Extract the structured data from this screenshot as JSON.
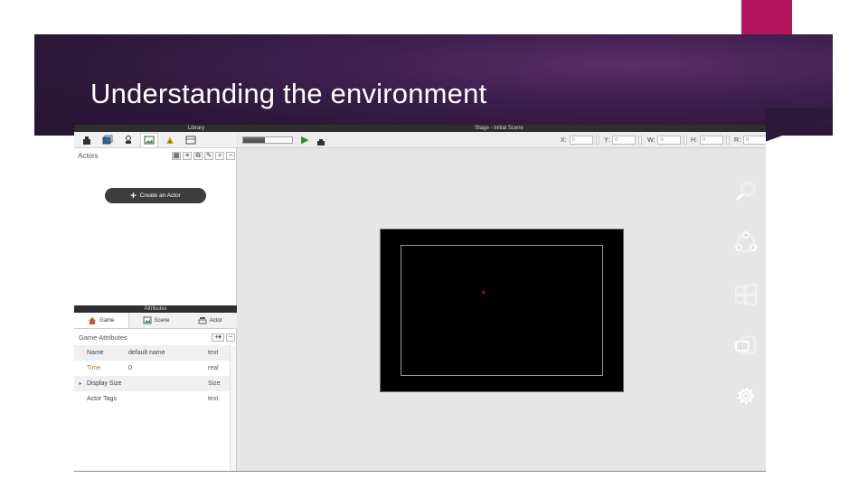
{
  "slide": {
    "title": "Understanding the environment",
    "accent_color": "#b5175e",
    "banner_color": "#2c1838"
  },
  "app": {
    "library_title": "Library",
    "scene_title": "Stage - Initial Scene",
    "library_tabs": [
      "actors-tab-icon",
      "scenes-tab-icon",
      "behaviors-tab-icon",
      "images-tab-icon",
      "sounds-tab-icon",
      "tables-tab-icon"
    ],
    "actors_label": "Actors",
    "actors_buttons": [
      "grid",
      "list",
      "duplicate",
      "delete",
      "+",
      "−"
    ],
    "create_actor_label": "Create an Actor",
    "attributes": {
      "header": "Attributes",
      "tabs": [
        "Game",
        "Scene",
        "Actor"
      ],
      "section_label": "Game Attributes",
      "add_label": "+▾",
      "remove_label": "−",
      "rows": [
        {
          "name": "Name",
          "value": "default name",
          "type": "text",
          "expandable": false
        },
        {
          "name": "Time",
          "value": "0",
          "type": "real",
          "expandable": false
        },
        {
          "name": "Display Size",
          "value": "",
          "type": "Size",
          "expandable": true
        },
        {
          "name": "Actor Tags",
          "value": "",
          "type": "text",
          "expandable": false
        }
      ]
    },
    "scene_toolbar": {
      "coords": [
        {
          "label": "X:",
          "value": "0"
        },
        {
          "label": "Y:",
          "value": "0"
        },
        {
          "label": "W:",
          "value": "0"
        },
        {
          "label": "H:",
          "value": "0"
        },
        {
          "label": "R:",
          "value": "0"
        }
      ]
    },
    "stage": {
      "origin_marker": "+",
      "background": "#000000"
    }
  },
  "charms": [
    "search-icon",
    "share-icon",
    "start-icon",
    "devices-icon",
    "settings-icon"
  ]
}
